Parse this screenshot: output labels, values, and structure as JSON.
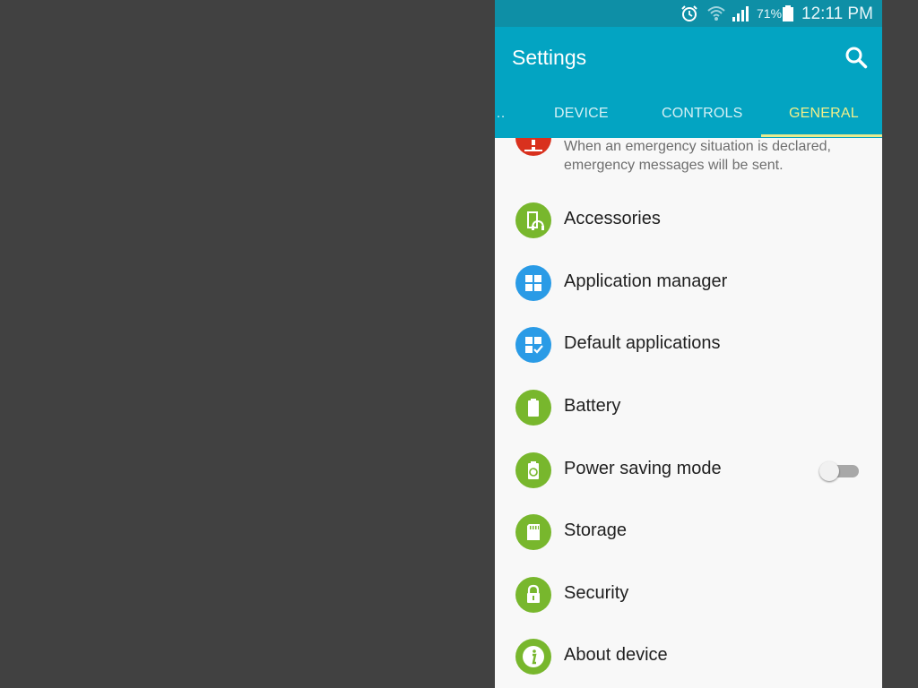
{
  "status_bar": {
    "battery_percent": "71%",
    "time": "12:11 PM",
    "icons": [
      "alarm-icon",
      "wifi-icon",
      "signal-icon",
      "battery-icon"
    ]
  },
  "app_bar": {
    "title": "Settings",
    "search_icon": "search-icon"
  },
  "tabs": [
    {
      "label": "…",
      "active": false
    },
    {
      "label": "DEVICE",
      "active": false
    },
    {
      "label": "CONTROLS",
      "active": false
    },
    {
      "label": "GENERAL",
      "active": true
    }
  ],
  "emergency": {
    "description": "When an emergency situation is declared, emergency messages will be sent.",
    "icon": "emergency-icon"
  },
  "items": [
    {
      "label": "Accessories",
      "icon": "accessories-icon"
    },
    {
      "label": "Application manager",
      "icon": "apps-grid-icon"
    },
    {
      "label": "Default applications",
      "icon": "default-apps-icon"
    },
    {
      "label": "Battery",
      "icon": "battery-icon"
    },
    {
      "label": "Power saving mode",
      "icon": "power-saving-icon",
      "toggle": false
    },
    {
      "label": "Storage",
      "icon": "sd-card-icon"
    },
    {
      "label": "Security",
      "icon": "lock-icon"
    },
    {
      "label": "About device",
      "icon": "info-icon"
    }
  ],
  "colors": {
    "status_bar": "#0e8fa6",
    "app_bar": "#03a4c2",
    "active_tab": "#f0ef8a",
    "icon_green": "#78b72d",
    "icon_blue": "#2a9be6",
    "icon_red": "#d9311e",
    "outer_background": "#414141"
  }
}
